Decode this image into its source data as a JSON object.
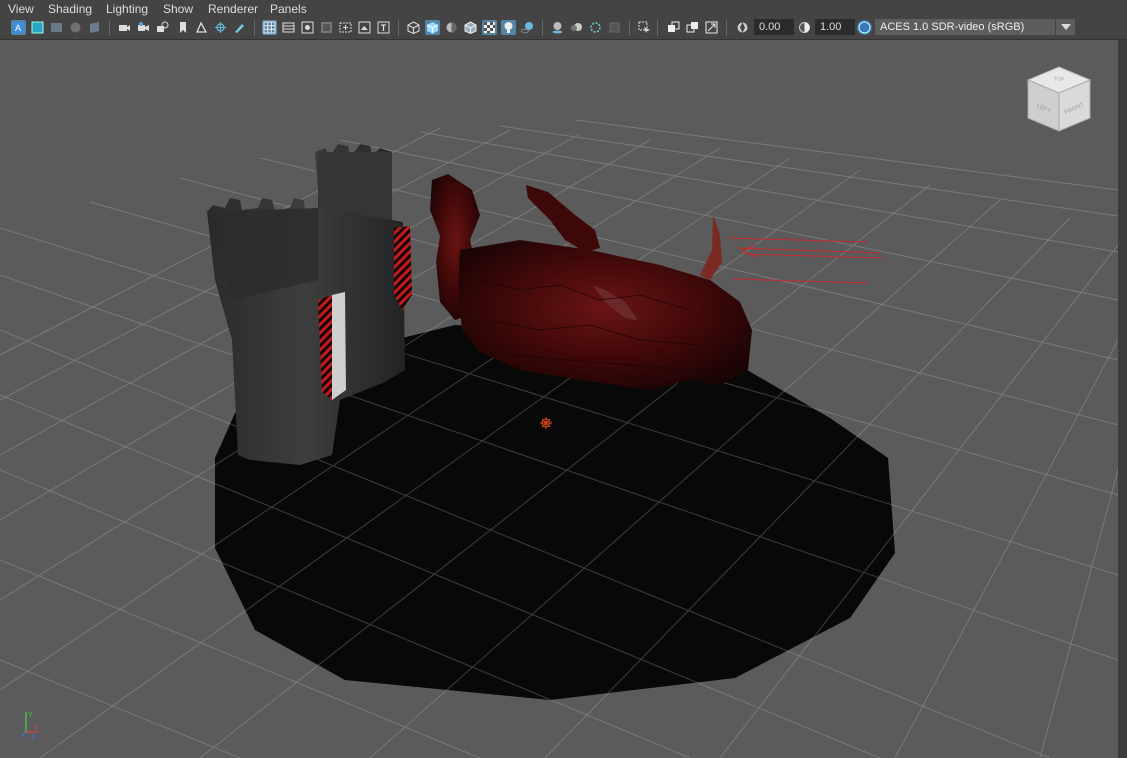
{
  "menu": [
    "View",
    "Shading",
    "Lighting",
    "Show",
    "Renderer",
    "Panels"
  ],
  "toolbar": {
    "exposure_value": "0.00",
    "gamma_value": "1.00",
    "color_space": "ACES 1.0 SDR-video (sRGB)",
    "cm_badge": "ON"
  },
  "viewcube": {
    "faces": [
      "TOP",
      "LEFT",
      "FRONT"
    ]
  },
  "axis_gizmo": {
    "labels": [
      "Y",
      "X",
      "Z"
    ]
  },
  "colors": {
    "viewport_bg": "#5b5b5b",
    "grid_line": "#7a7a7a",
    "floor": "#080808",
    "highlight": "#5285a6",
    "dragon_red": "#4a0c0c"
  }
}
